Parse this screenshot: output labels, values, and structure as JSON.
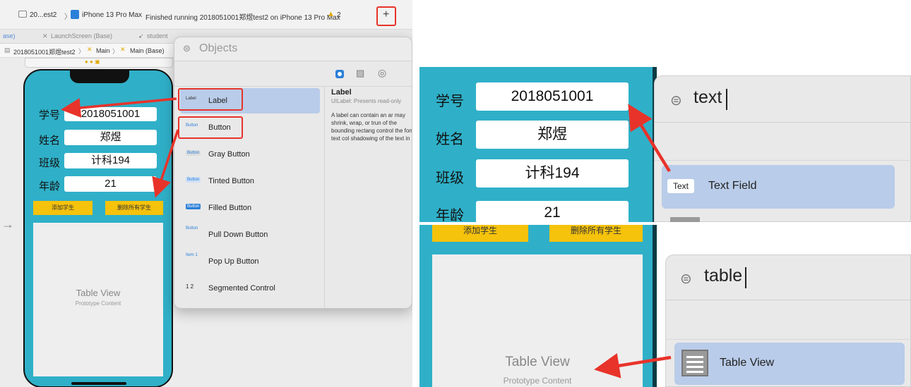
{
  "toolbar": {
    "scheme_label": "20...est2",
    "device_label": "iPhone 13 Pro Max",
    "status_text": "Finished running 2018051001郑煜test2 on iPhone 13 Pro Max",
    "warning_count": "2",
    "add_button_label": "+"
  },
  "tabs": {
    "tab1": "ase)",
    "tab2": "LaunchScreen (Base)",
    "tab3": "student"
  },
  "breadcrumb": {
    "project": "2018051001郑煜test2",
    "main": "Main",
    "main_base": "Main (Base)"
  },
  "form": {
    "student_id_label": "学号",
    "student_id_value": "2018051001",
    "name_label": "姓名",
    "name_value": "郑煜",
    "class_label": "班级",
    "class_value": "计科194",
    "age_label": "年龄",
    "age_value": "21",
    "add_button": "添加学生",
    "delete_all_button": "删除所有学生",
    "add_button_partial": "添加学生",
    "delete_all_partial": "删除所有学生"
  },
  "table_view": {
    "title": "Table View",
    "subtitle": "Prototype Content"
  },
  "library": {
    "search_placeholder": "Objects",
    "items": [
      {
        "chip": "Label",
        "label": "Label"
      },
      {
        "chip": "Button",
        "label": "Button"
      },
      {
        "chip": "Button",
        "label": "Gray Button"
      },
      {
        "chip": "Button",
        "label": "Tinted Button"
      },
      {
        "chip": "Button",
        "label": "Filled Button"
      },
      {
        "chip": "Button",
        "label": "Pull Down Button"
      },
      {
        "chip": "Item 1",
        "label": "Pop Up Button"
      },
      {
        "chip": "1 2",
        "label": "Segmented Control"
      }
    ],
    "detail_title": "Label",
    "detail_subtitle": "UILabel: Presents read-only",
    "detail_body": "A label can contain an ar may shrink, wrap, or trun of the bounding rectang control the font, text col shadowing of the text in"
  },
  "zoom_search1": {
    "query": "text",
    "result_chip": "Text",
    "result_label": "Text Field"
  },
  "zoom_search2": {
    "query": "table",
    "result_label": "Table View"
  },
  "colors": {
    "phone_bg": "#2fb0c8",
    "button_yellow": "#f5c20c",
    "highlight": "#b9cce9",
    "annotation_red": "#e8332a"
  }
}
